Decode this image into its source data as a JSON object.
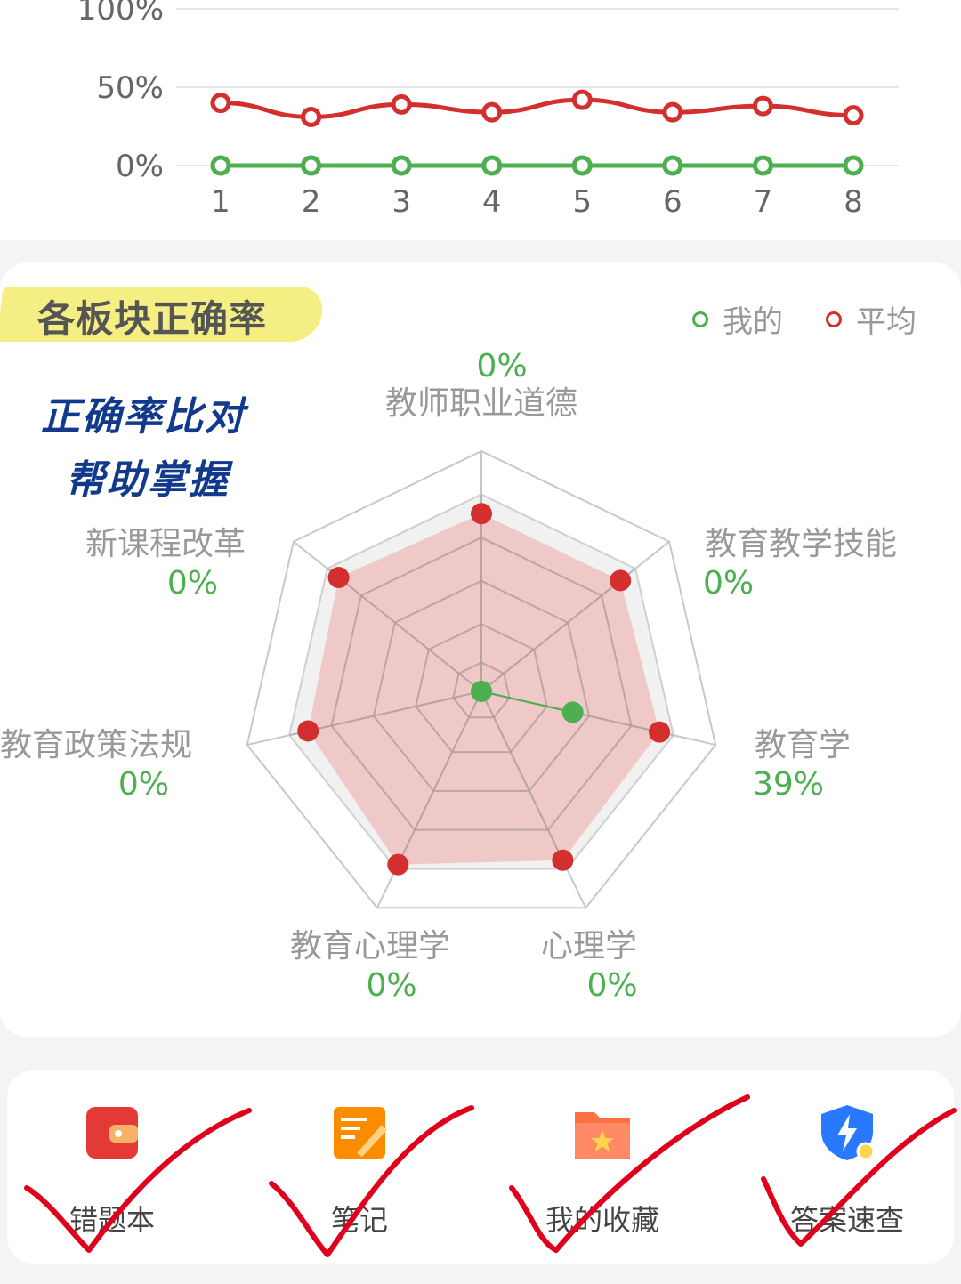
{
  "line_chart": {
    "y_ticks": [
      "100%",
      "50%",
      "0%"
    ],
    "x_ticks": [
      "1",
      "2",
      "3",
      "4",
      "5",
      "6",
      "7",
      "8"
    ]
  },
  "section": {
    "title": "各板块正确率",
    "legend": [
      {
        "label": "我的",
        "color": "#4caf50"
      },
      {
        "label": "平均",
        "color": "#d32f2f"
      }
    ]
  },
  "overlay": {
    "line1": "正确率比对",
    "line2": "帮助掌握"
  },
  "chart_data": [
    {
      "type": "line",
      "x": [
        1,
        2,
        3,
        4,
        5,
        6,
        7,
        8
      ],
      "ylim": [
        0,
        100
      ],
      "series": [
        {
          "values": [
            40,
            31,
            39,
            34,
            42,
            34,
            38,
            32
          ],
          "color": "#d32f2f"
        },
        {
          "values": [
            0,
            0,
            0,
            0,
            0,
            0,
            0,
            0
          ],
          "color": "#4caf50"
        }
      ]
    },
    {
      "type": "radar",
      "categories": [
        "教师职业道德",
        "教育教学技能",
        "教育学",
        "心理学",
        "教育心理学",
        "教育政策法规",
        "新课程改革"
      ],
      "value_labels": [
        "0%",
        "0%",
        "39%",
        "0%",
        "0%",
        "0%",
        "0%"
      ],
      "rmax": 100,
      "series": [
        {
          "name": "我的",
          "values": [
            0,
            0,
            39,
            0,
            0,
            0,
            0
          ],
          "color": "#4caf50"
        },
        {
          "name": "平均",
          "values": [
            74,
            74,
            76,
            78,
            80,
            74,
            76
          ],
          "color": "#d32f2f"
        }
      ]
    }
  ],
  "tools": [
    {
      "label": "错题本",
      "icon": "wallet-icon",
      "color": "#e53935"
    },
    {
      "label": "笔记",
      "icon": "note-icon",
      "color": "#fb8c00"
    },
    {
      "label": "我的收藏",
      "icon": "folder-star-icon",
      "color": "#ff7043"
    },
    {
      "label": "答案速查",
      "icon": "shield-bolt-icon",
      "color": "#2979ff"
    }
  ]
}
